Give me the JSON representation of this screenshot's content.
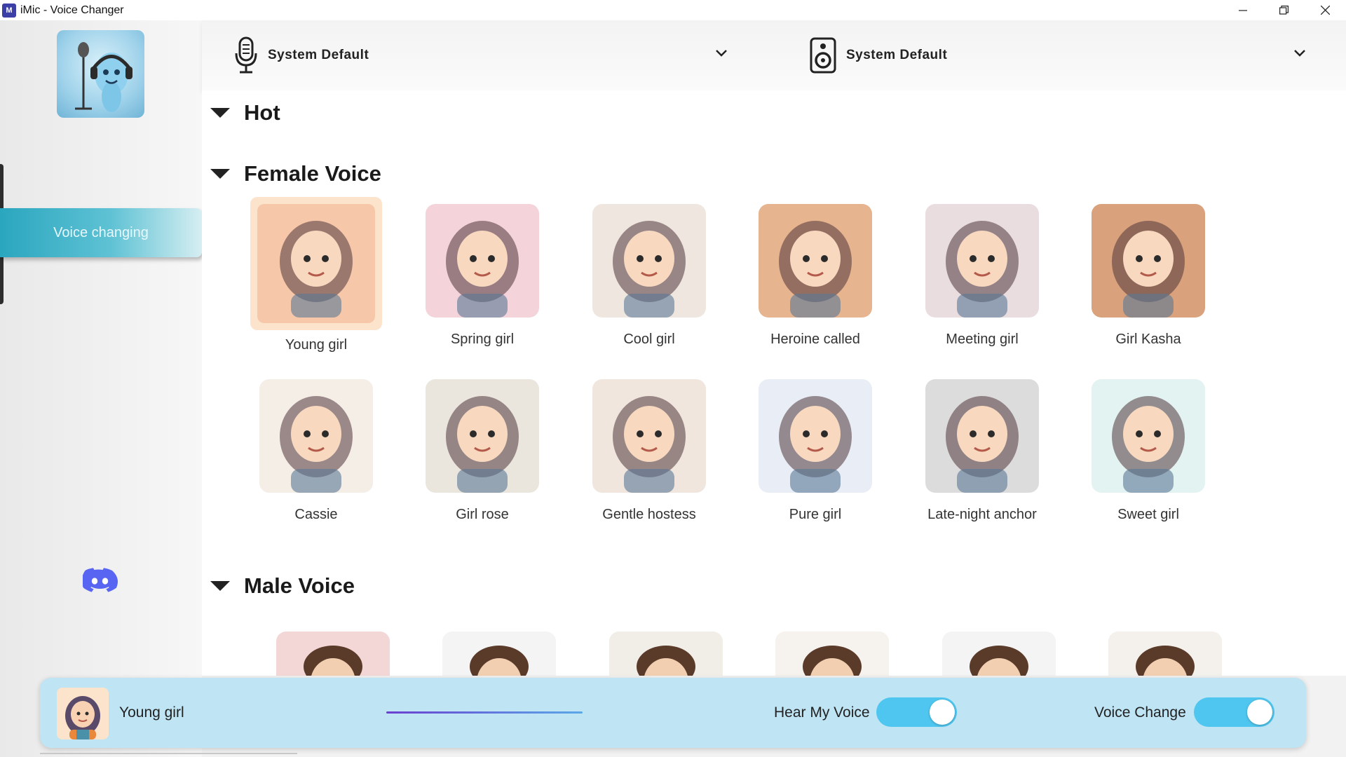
{
  "window": {
    "title": "iMic - Voice Changer",
    "icon_letter": "M",
    "controls": [
      "minimize",
      "restore",
      "close"
    ]
  },
  "sidebar": {
    "active_item": "Voice changing",
    "discord_icon": "discord-icon"
  },
  "devices": {
    "input": {
      "label": "System Default",
      "icon": "microphone-icon"
    },
    "output": {
      "label": "System Default",
      "icon": "speaker-icon"
    }
  },
  "sections": {
    "hot": {
      "title": "Hot"
    },
    "female": {
      "title": "Female Voice",
      "voices": [
        {
          "name": "Young girl",
          "color": "#f6c7a8",
          "selected": true
        },
        {
          "name": "Spring girl",
          "color": "#f4d3da"
        },
        {
          "name": "Cool girl",
          "color": "#efe7df"
        },
        {
          "name": "Heroine called",
          "color": "#e6b48e"
        },
        {
          "name": "Meeting girl",
          "color": "#e9dde0"
        },
        {
          "name": "Girl Kasha",
          "color": "#d9a27c"
        },
        {
          "name": "Cassie",
          "color": "#f5eee7"
        },
        {
          "name": "Girl rose",
          "color": "#eae5dd"
        },
        {
          "name": "Gentle hostess",
          "color": "#f0e6de"
        },
        {
          "name": "Pure girl",
          "color": "#e9eef6"
        },
        {
          "name": "Late-night anchor",
          "color": "#dcdcdc"
        },
        {
          "name": "Sweet girl",
          "color": "#e3f3f1"
        }
      ]
    },
    "male": {
      "title": "Male Voice",
      "voices": [
        {
          "color": "#f3d7d7"
        },
        {
          "color": "#f4f4f4"
        },
        {
          "color": "#f1ede7"
        },
        {
          "color": "#f6f2ee"
        },
        {
          "color": "#f4f4f4"
        },
        {
          "color": "#f4f1ec"
        }
      ]
    }
  },
  "player": {
    "current_voice": "Young girl",
    "hear_my_voice": {
      "label": "Hear My Voice",
      "on": true
    },
    "voice_change": {
      "label": "Voice Change",
      "on": true
    }
  },
  "colors": {
    "accent": "#4fc6ef",
    "nav_active": "#2aa6bf",
    "player_bg": "#bfe4f4",
    "selected_bg": "#fbe3cc"
  }
}
